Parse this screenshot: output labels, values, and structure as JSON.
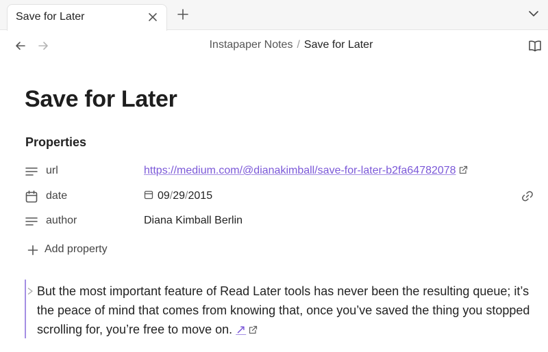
{
  "tabs": [
    {
      "label": "Save for Later",
      "active": true
    }
  ],
  "breadcrumb": {
    "parent": "Instapaper Notes",
    "separator": "/",
    "current": "Save for Later"
  },
  "page": {
    "title": "Save for Later"
  },
  "properties": {
    "heading": "Properties",
    "items": [
      {
        "name": "url",
        "icon": "text-lines-icon",
        "value": "https://medium.com/@dianakimball/save-for-later-b2fa64782078",
        "type": "link"
      },
      {
        "name": "date",
        "icon": "calendar-icon",
        "month": "09",
        "day": "29",
        "year": "2015",
        "date_separator": "/",
        "type": "date"
      },
      {
        "name": "author",
        "icon": "text-lines-icon",
        "value": "Diana Kimball Berlin",
        "type": "text"
      }
    ],
    "add_label": "Add property"
  },
  "quote": {
    "text": "But the most important feature of Read Later tools has never been the resulting queue; it’s the peace of mind that comes from knowing that, once you’ve saved the thing you stopped scrolling for, you’re free to move on.",
    "link_glyph": "↗"
  },
  "colors": {
    "accent": "#7b58d8",
    "quote_border": "#a48ee4",
    "tabbar_bg": "#f6f6f6"
  }
}
